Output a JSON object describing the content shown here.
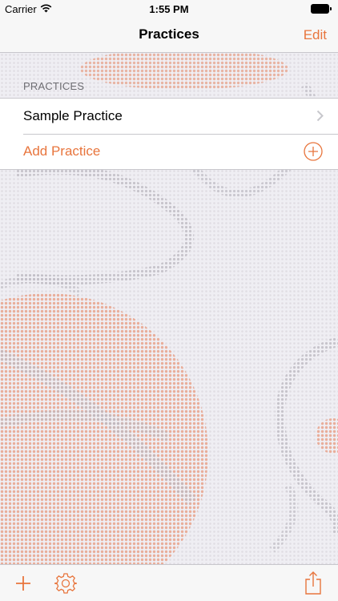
{
  "status_bar": {
    "carrier": "Carrier",
    "time": "1:55 PM"
  },
  "nav": {
    "title": "Practices",
    "edit_label": "Edit"
  },
  "section": {
    "header": "PRACTICES",
    "items": [
      {
        "label": "Sample Practice"
      }
    ],
    "add_label": "Add Practice"
  },
  "toolbar": {
    "icons": [
      "plus-icon",
      "gear-icon",
      "share-icon"
    ]
  },
  "colors": {
    "accent": "#e8753d",
    "background": "#efeef3"
  }
}
